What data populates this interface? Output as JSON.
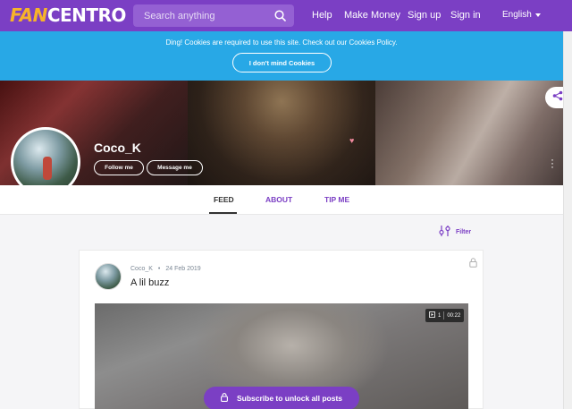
{
  "header": {
    "logo_left": "FAN",
    "logo_right": "CENTRO",
    "search_placeholder": "Search anything",
    "nav": [
      "Help",
      "Make Money",
      "Sign up",
      "Sign in"
    ],
    "language": "English"
  },
  "cookie_banner": {
    "message": "Ding! Cookies are required to use this site. Check out our Cookies Policy.",
    "button": "I don't mind Cookies"
  },
  "profile": {
    "name": "Coco_K",
    "follow_button": "Follow me",
    "message_button": "Message me"
  },
  "tabs": [
    {
      "label": "FEED",
      "active": true
    },
    {
      "label": "ABOUT",
      "active": false
    },
    {
      "label": "TIP ME",
      "active": false
    }
  ],
  "filter_label": "Filter",
  "post": {
    "author": "Coco_K",
    "date": "24 Feb 2019",
    "title": "A lil buzz",
    "media_count": "1",
    "media_duration": "00:22",
    "unlock_button": "Subscribe to unlock all posts"
  },
  "colors": {
    "brand_purple": "#7b3fc4",
    "cookie_blue": "#28a8e6",
    "logo_orange": "#f6b32a"
  },
  "icons": [
    "search-icon",
    "chevron-down-icon",
    "share-icon",
    "kebab-menu-icon",
    "filter-icon",
    "lock-icon",
    "media-count-icon",
    "unlock-icon"
  ]
}
